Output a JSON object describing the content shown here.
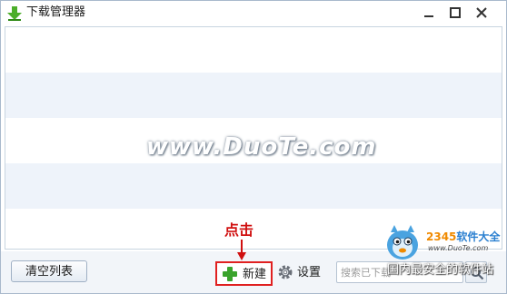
{
  "window": {
    "title": "下载管理器"
  },
  "list": {
    "rows": 5
  },
  "watermark": "www.DuoTe.com",
  "toolbar": {
    "clear_label": "清空列表",
    "new_label": "新建",
    "settings_label": "设置",
    "search_placeholder": "搜索已下载"
  },
  "annotation": {
    "text": "点击"
  },
  "logo": {
    "site_name": "2345软件大全",
    "site_digits": "2345",
    "site_suffix": "软件大全",
    "url": "www.DuoTe.com",
    "slogan": "国内最安全的软件站"
  },
  "colors": {
    "accent_red": "#e02020",
    "plus_green": "#3aa32c",
    "row_alt": "#eef3fa"
  }
}
